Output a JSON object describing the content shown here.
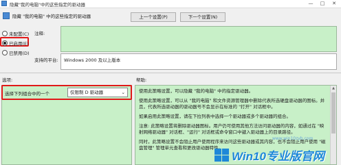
{
  "window": {
    "title": "隐藏\"我的电脑\"中的这些指定的驱动器",
    "minimize_glyph": "—",
    "maximize_glyph": "□",
    "close_glyph": "✕"
  },
  "header": {
    "policy_name": "隐藏 \"我的电脑\" 中的这些指定的驱动器",
    "prev_setting": "上一个设置(P)",
    "next_setting": "下一个设置(N)"
  },
  "state_options": [
    {
      "label": "未配置(C)",
      "selected": false
    },
    {
      "label": "已启用(E)",
      "selected": true
    },
    {
      "label": "已禁用(D)",
      "selected": false
    }
  ],
  "comment": {
    "label": "注释:",
    "value": ""
  },
  "supported": {
    "label": "支持的平台:",
    "value": "Windows 2000 及以上版本"
  },
  "options": {
    "label": "选项:",
    "combo_label": "选择下列组合中的一个",
    "selected_value": "仅限制 D 驱动器"
  },
  "help": {
    "label": "帮助:",
    "paragraphs": [
      "使用此策略设置，可以隐藏 \"我的电脑\" 中的指定驱动器。",
      "使用此策略设置，可以从 \"我的电脑\" 和文件资源管理器中删除代表所选硬盘驱动器的图标。并且，代表所选驱动器的驱动器号不会显示在标准的 \"打开\" 对话框中。",
      "如果启用此策略设置，请在下拉列表中选择一个驱动器或多个驱动器的组合。",
      "注意: 此策略设置将删除驱动器图标。用户仍可使用其他方法访问驱动器的内容，如通过在 \"映射网络驱动器\" 对话框、\"运行\" 对话框或命令窗口中键入驱动器上的目录路径。",
      "同时，此策略设置不会阻止用户使用程序来访问这些驱动器或其内容，也不会阻止用户使用 \"磁盘管理\" 管理单元查看和更改驱动器特性。"
    ]
  },
  "watermark": {
    "brand": "Win10专业版官网",
    "url": "www.win10zyb.com"
  }
}
